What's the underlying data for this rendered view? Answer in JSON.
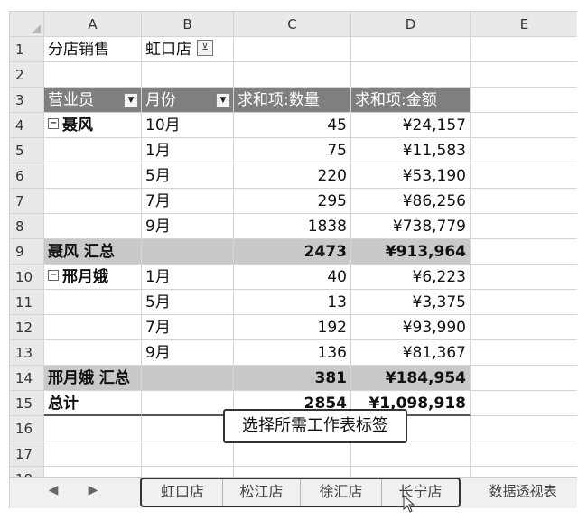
{
  "columns": [
    "A",
    "B",
    "C",
    "D",
    "E"
  ],
  "rows": [
    "1",
    "2",
    "3",
    "4",
    "5",
    "6",
    "7",
    "8",
    "9",
    "10",
    "11",
    "12",
    "13",
    "14",
    "15",
    "16",
    "17",
    "18"
  ],
  "filter": {
    "label": "分店销售",
    "value": "虹口店"
  },
  "pivot_headers": {
    "staff": "营业员",
    "month": "月份",
    "qty": "求和项:数量",
    "amount": "求和项:金额"
  },
  "groups": [
    {
      "name": "聂风",
      "items": [
        {
          "month": "10月",
          "qty": "45",
          "amount": "¥24,157"
        },
        {
          "month": "1月",
          "qty": "75",
          "amount": "¥11,583"
        },
        {
          "month": "5月",
          "qty": "220",
          "amount": "¥53,190"
        },
        {
          "month": "7月",
          "qty": "295",
          "amount": "¥86,256"
        },
        {
          "month": "9月",
          "qty": "1838",
          "amount": "¥738,779"
        }
      ],
      "subtotal": {
        "label": "聂风 汇总",
        "qty": "2473",
        "amount": "¥913,964"
      }
    },
    {
      "name": "邢月娥",
      "items": [
        {
          "month": "1月",
          "qty": "40",
          "amount": "¥6,223"
        },
        {
          "month": "5月",
          "qty": "13",
          "amount": "¥3,375"
        },
        {
          "month": "7月",
          "qty": "192",
          "amount": "¥93,990"
        },
        {
          "month": "9月",
          "qty": "136",
          "amount": "¥81,367"
        }
      ],
      "subtotal": {
        "label": "邢月娥 汇总",
        "qty": "381",
        "amount": "¥184,954"
      }
    }
  ],
  "grand_total": {
    "label": "总计",
    "qty": "2854",
    "amount": "¥1,098,918"
  },
  "callout": "选择所需工作表标签",
  "sheet_tabs": [
    "虹口店",
    "松江店",
    "徐汇店",
    "长宁店",
    "数据透视表"
  ],
  "icons": {
    "filter": "filter-applied-icon",
    "dropdown": "dropdown-arrow-icon",
    "collapse": "collapse-minus-icon",
    "nav_prev": "scroll-left-icon",
    "nav_next": "scroll-right-icon",
    "cursor": "mouse-pointer-icon"
  },
  "colors": {
    "pivot_header": "#7f7f7f",
    "subtotal_row": "#c9c9c9",
    "header_bg": "#e9e9e9"
  }
}
